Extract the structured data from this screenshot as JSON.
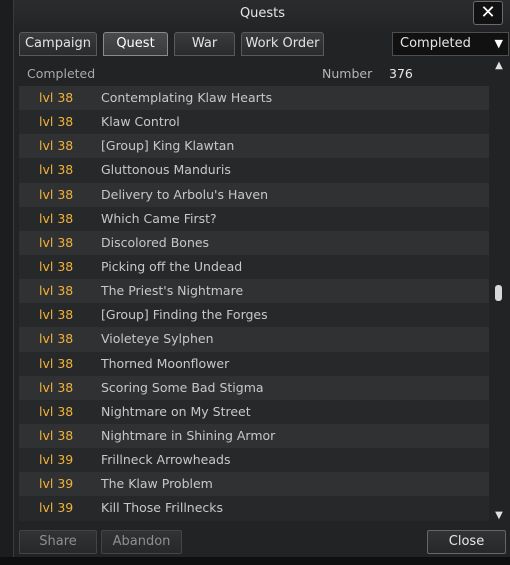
{
  "window": {
    "title": "Quests",
    "close_icon": "✕"
  },
  "tabs": [
    {
      "label": "Campaign",
      "active": false
    },
    {
      "label": "Quest",
      "active": true
    },
    {
      "label": "War",
      "active": false
    },
    {
      "label": "Work Order",
      "active": false
    }
  ],
  "filter": {
    "selected": "Completed",
    "arrow_icon": "▼"
  },
  "list_header": {
    "completed_label": "Completed",
    "number_label": "Number",
    "number_value": "376"
  },
  "quests": [
    {
      "level": "lvl 38",
      "name": "Contemplating Klaw Hearts"
    },
    {
      "level": "lvl 38",
      "name": "Klaw Control"
    },
    {
      "level": "lvl 38",
      "name": "[Group] King Klawtan"
    },
    {
      "level": "lvl 38",
      "name": "Gluttonous Manduris"
    },
    {
      "level": "lvl 38",
      "name": "Delivery to Arbolu's Haven"
    },
    {
      "level": "lvl 38",
      "name": "Which Came First?"
    },
    {
      "level": "lvl 38",
      "name": "Discolored Bones"
    },
    {
      "level": "lvl 38",
      "name": "Picking off the Undead"
    },
    {
      "level": "lvl 38",
      "name": "The Priest's Nightmare"
    },
    {
      "level": "lvl 38",
      "name": "[Group] Finding the Forges"
    },
    {
      "level": "lvl 38",
      "name": "Violeteye Sylphen"
    },
    {
      "level": "lvl 38",
      "name": "Thorned Moonflower"
    },
    {
      "level": "lvl 38",
      "name": "Scoring Some Bad Stigma"
    },
    {
      "level": "lvl 38",
      "name": "Nightmare on My Street"
    },
    {
      "level": "lvl 38",
      "name": "Nightmare in Shining Armor"
    },
    {
      "level": "lvl 39",
      "name": "Frillneck Arrowheads"
    },
    {
      "level": "lvl 39",
      "name": "The Klaw Problem"
    },
    {
      "level": "lvl 39",
      "name": "Kill Those Frillnecks"
    }
  ],
  "scrollbar": {
    "up_icon": "▲",
    "down_icon": "▼"
  },
  "footer": {
    "share_label": "Share",
    "abandon_label": "Abandon",
    "close_label": "Close"
  },
  "colors": {
    "level_text": "#f2b13c",
    "window_bg": "#222325"
  }
}
